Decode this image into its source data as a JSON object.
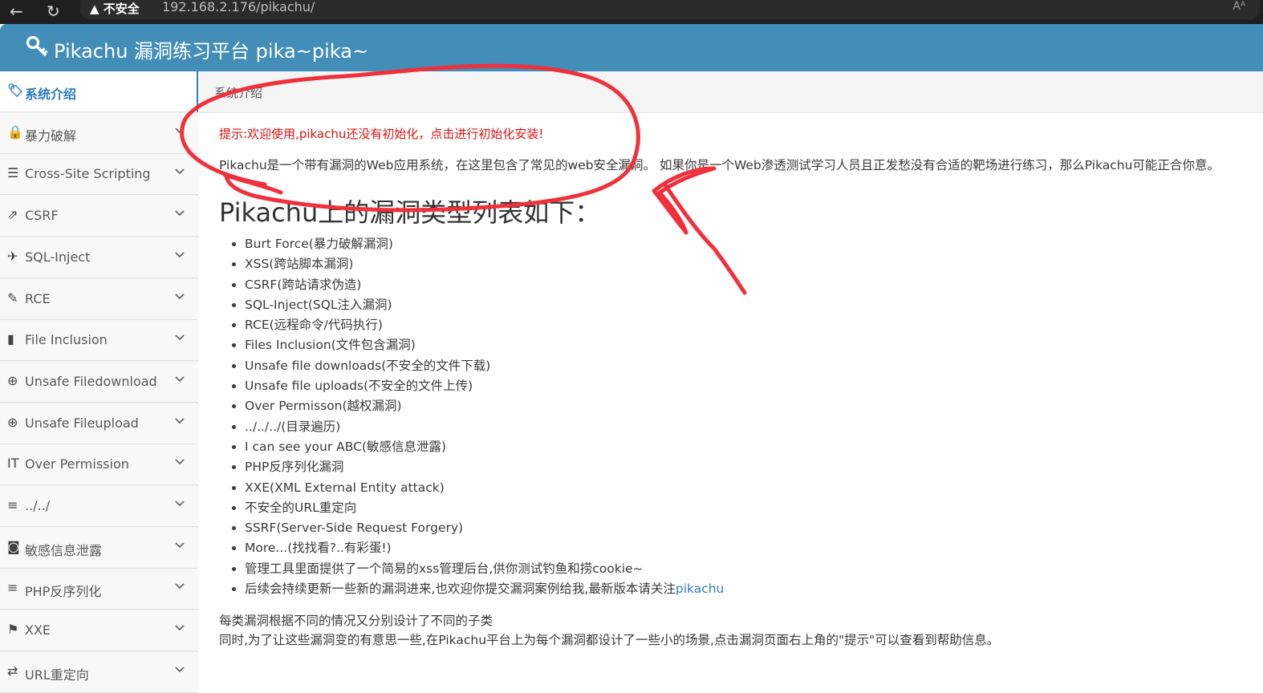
{
  "browser": {
    "back_icon": "←",
    "reload_icon": "↻",
    "security_warning": "▲ 不安全",
    "url": "192.168.2.176/pikachu/",
    "read_aloud": "Aᴬ"
  },
  "header": {
    "title": "Pikachu 漏洞练习平台 pika~pika~",
    "icon": "key-icon"
  },
  "sidebar": {
    "items": [
      {
        "label": "系统介绍",
        "icon": "tags-icon",
        "glyph": "🏷"
      },
      {
        "label": "暴力破解",
        "icon": "lock-icon",
        "glyph": "🔒"
      },
      {
        "label": "Cross-Site Scripting",
        "icon": "list-tree-icon",
        "glyph": "☰"
      },
      {
        "label": "CSRF",
        "icon": "share-icon",
        "glyph": "⇗"
      },
      {
        "label": "SQL-Inject",
        "icon": "plane-icon",
        "glyph": "✈"
      },
      {
        "label": "RCE",
        "icon": "pencil-icon",
        "glyph": "✎"
      },
      {
        "label": "File Inclusion",
        "icon": "file-icon",
        "glyph": "▮"
      },
      {
        "label": "Unsafe Filedownload",
        "icon": "download-circle-icon",
        "glyph": "⊕"
      },
      {
        "label": "Unsafe Fileupload",
        "icon": "upload-circle-icon",
        "glyph": "⊕"
      },
      {
        "label": "Over Permission",
        "icon": "text-height-icon",
        "glyph": "ⅠT"
      },
      {
        "label": "../../",
        "icon": "align-left-icon",
        "glyph": "≡"
      },
      {
        "label": "敏感信息泄露",
        "icon": "camera-icon",
        "glyph": "◙"
      },
      {
        "label": "PHP反序列化",
        "icon": "align-left-icon",
        "glyph": "≡"
      },
      {
        "label": "XXE",
        "icon": "flag-icon",
        "glyph": "⚑"
      },
      {
        "label": "URL重定向",
        "icon": "redirect-icon",
        "glyph": "⇄"
      }
    ]
  },
  "breadcrumb": {
    "current": "系统介绍"
  },
  "main": {
    "notice": "提示:欢迎使用,pikachu还没有初始化，点击进行初始化安装!",
    "intro": "Pikachu是一个带有漏洞的Web应用系统，在这里包含了常见的web安全漏洞。 如果你是一个Web渗透测试学习人员且正发愁没有合适的靶场进行练习，那么Pikachu可能正合你意。",
    "heading": "Pikachu上的漏洞类型列表如下：",
    "list": [
      "Burt Force(暴力破解漏洞)",
      "XSS(跨站脚本漏洞)",
      "CSRF(跨站请求伪造)",
      "SQL-Inject(SQL注入漏洞)",
      "RCE(远程命令/代码执行)",
      "Files Inclusion(文件包含漏洞)",
      "Unsafe file downloads(不安全的文件下载)",
      "Unsafe file uploads(不安全的文件上传)",
      "Over Permisson(越权漏洞)",
      "../../../(目录遍历)",
      "I can see your ABC(敏感信息泄露)",
      "PHP反序列化漏洞",
      "XXE(XML External Entity attack)",
      "不安全的URL重定向",
      "SSRF(Server-Side Request Forgery)",
      "More...(找找看?..有彩蛋!)",
      "管理工具里面提供了一个简易的xss管理后台,供你测试钓鱼和捞cookie~"
    ],
    "last_item_text": "后续会持续更新一些新的漏洞进来,也欢迎你提交漏洞案例给我,最新版本请关注",
    "last_item_link": "pikachu",
    "para1": "每类漏洞根据不同的情况又分别设计了不同的子类",
    "para2": "同时,为了让这些漏洞变的有意思一些,在Pikachu平台上为每个漏洞都设计了一些小的场景,点击漏洞页面右上角的\"提示\"可以查看到帮助信息。"
  },
  "colors": {
    "header_bg": "#438eb9",
    "active_text": "#2b7dbc",
    "notice_red": "#dd1111",
    "annotation_red": "#f0303a"
  }
}
